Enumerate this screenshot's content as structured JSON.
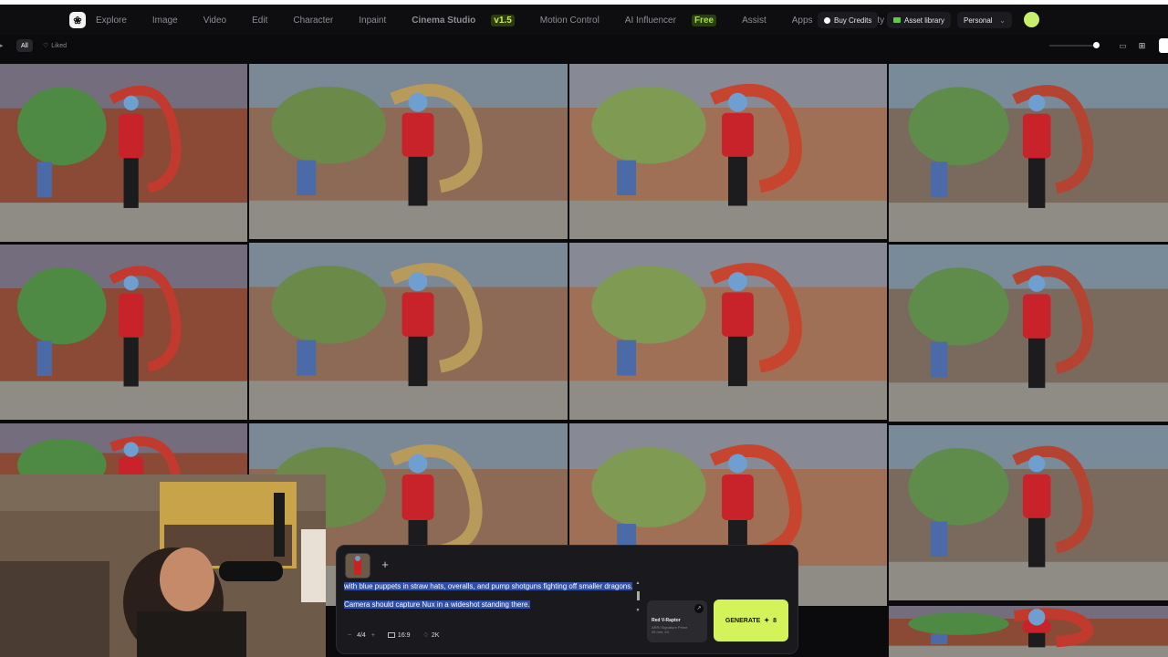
{
  "nav": {
    "items": [
      {
        "label": "Explore",
        "style": "bright"
      },
      {
        "label": "Image",
        "style": "dim"
      },
      {
        "label": "Video",
        "style": "dim"
      },
      {
        "label": "Edit",
        "style": "dim"
      },
      {
        "label": "Character",
        "style": "dim"
      },
      {
        "label": "Inpaint",
        "style": "bright"
      },
      {
        "label": "Cinema Studio",
        "style": "bold",
        "badge": "v1.5"
      },
      {
        "label": "Motion Control",
        "style": "bright"
      },
      {
        "label": "AI Influencer",
        "style": "bright",
        "badge": "Free"
      },
      {
        "label": "Assist",
        "style": "bright"
      },
      {
        "label": "Apps",
        "style": "bright"
      },
      {
        "label": "Community",
        "style": "bright"
      }
    ],
    "buy_credits": "Buy Credits",
    "asset_library": "Asset library",
    "workspace": "Personal"
  },
  "filters": {
    "all": "All",
    "liked": "Liked"
  },
  "composer": {
    "prompt_line1": "with blue puppets in straw hats, overalls, and pump shotguns fighting off smaller dragons.",
    "prompt_line2": "Camera should capture Nux in a wideshot standing there.",
    "count": "4/4",
    "aspect": "16:9",
    "resolution": "2K",
    "model_name": "Red V-Raptor",
    "model_sub": "ARRI Signature Prime 35 mm, f/4",
    "generate_label": "GENERATE",
    "generate_cost": "8"
  },
  "colors": {
    "accent": "#d4f25a",
    "avatar": "#c6ef6e",
    "highlight": "#2f4fa8"
  }
}
